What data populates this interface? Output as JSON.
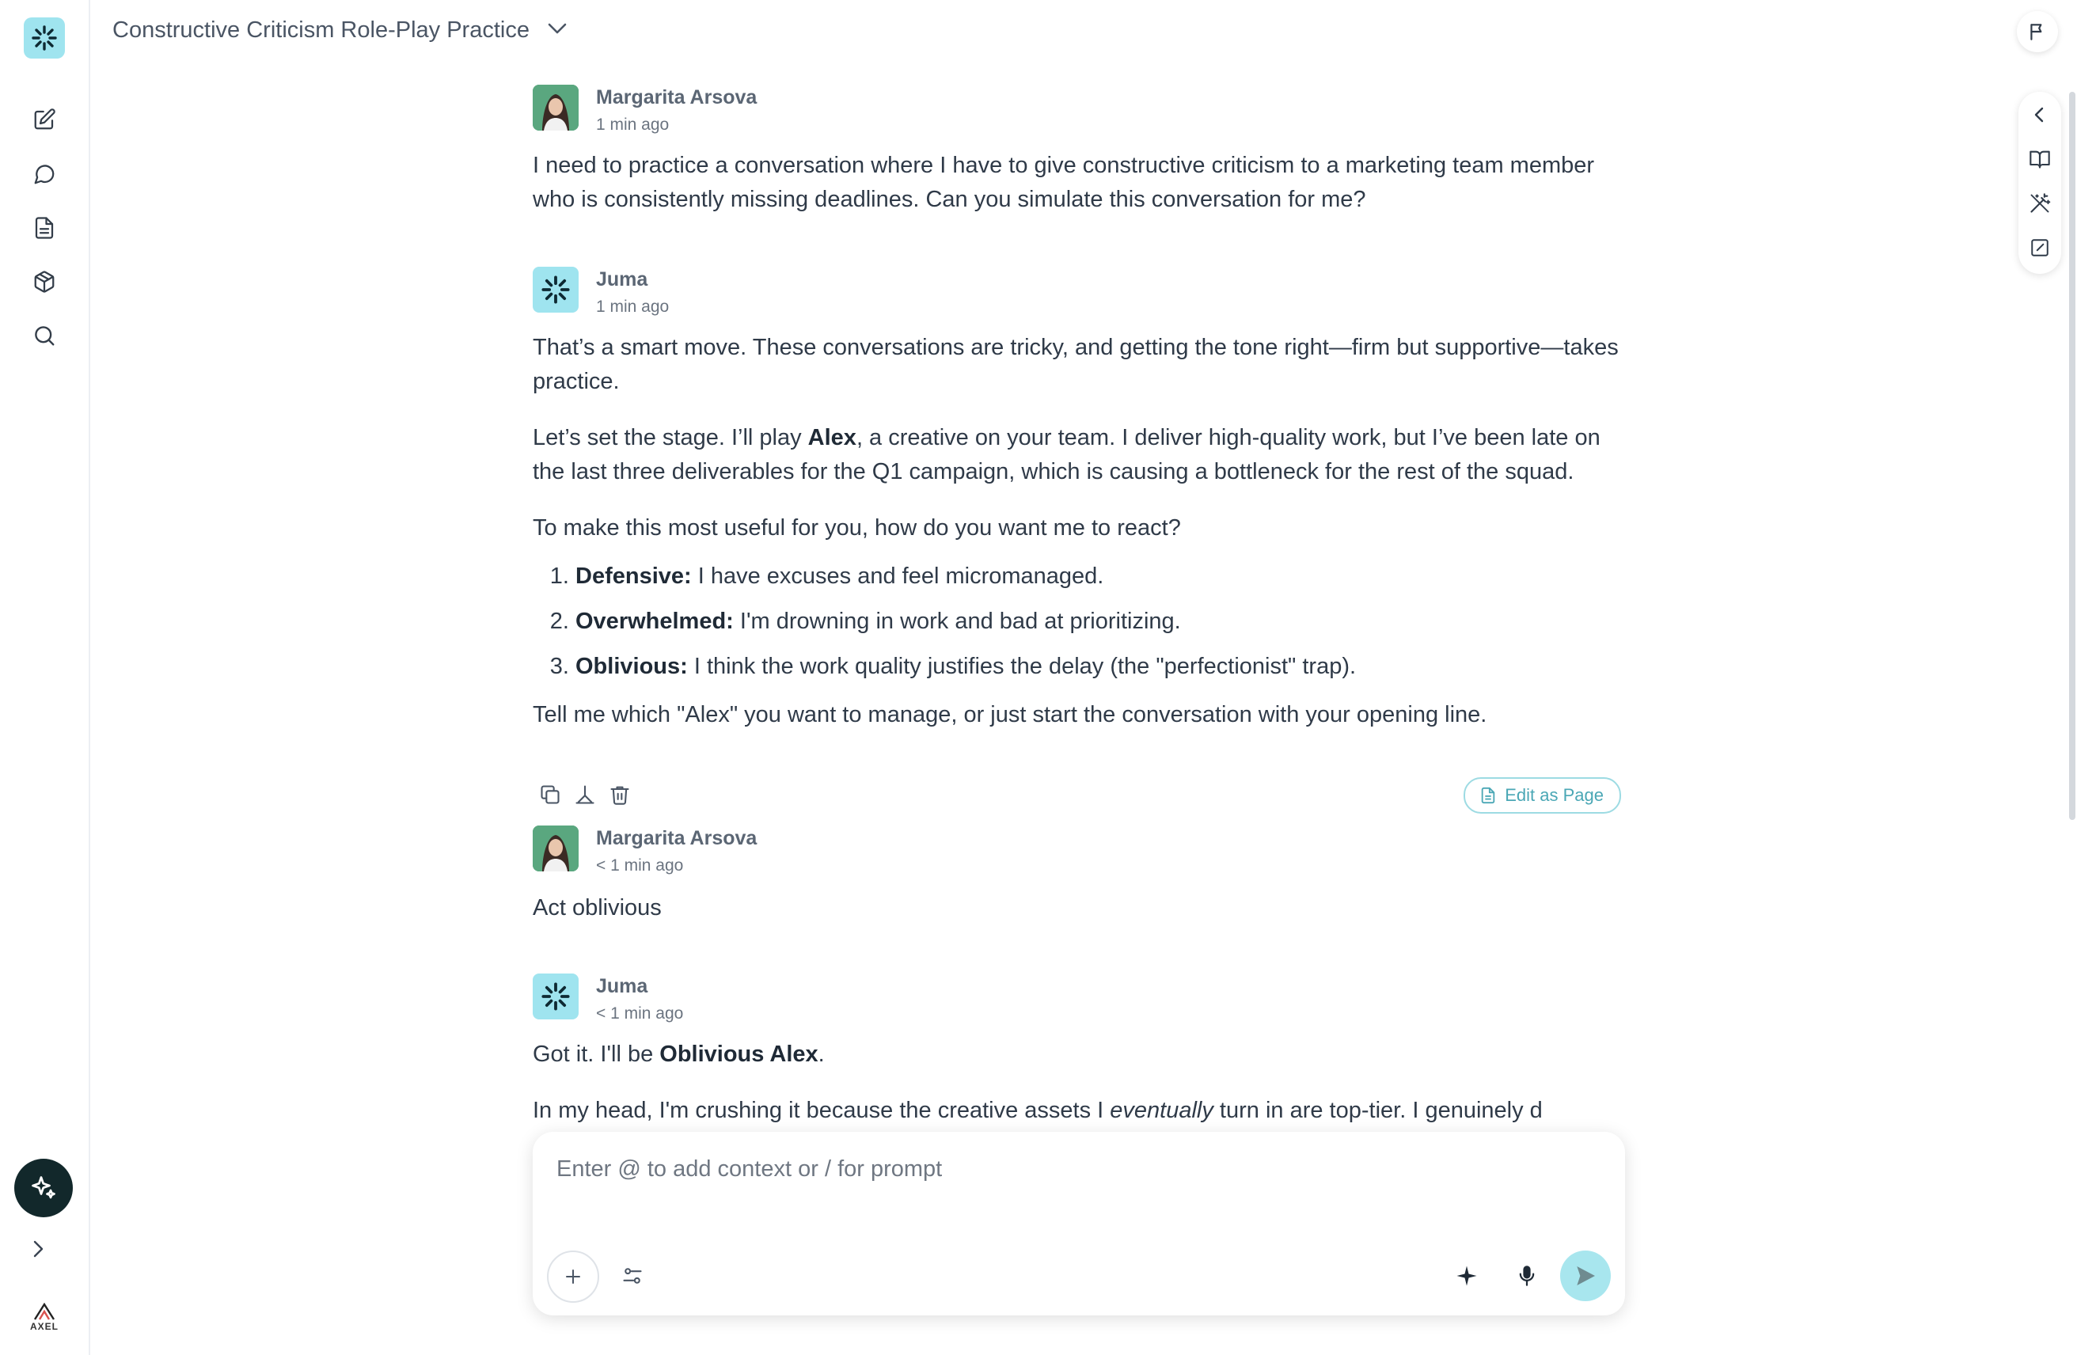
{
  "header": {
    "conversation_title": "Constructive Criticism Role-Play Practice"
  },
  "sidebar": {
    "items": [
      {
        "name": "new-note",
        "icon": "edit-icon"
      },
      {
        "name": "chats",
        "icon": "chat-bubble-icon"
      },
      {
        "name": "documents",
        "icon": "document-icon"
      },
      {
        "name": "packages",
        "icon": "cube-icon"
      },
      {
        "name": "search",
        "icon": "search-icon"
      }
    ],
    "brand_text": "AXEL"
  },
  "messages": [
    {
      "author": "Margarita Arsova",
      "time": "1 min ago",
      "text": "I need to practice a conversation where I have to give constructive criticism to a marketing team member who is consistently missing deadlines. Can you simulate this conversation for me?"
    },
    {
      "author": "Juma",
      "time": "1 min ago",
      "p1": "That’s a smart move. These conversations are tricky, and getting the tone right—firm but supportive—takes practice.",
      "p2_a": "Let’s set the stage. I’ll play ",
      "p2_bold": "Alex",
      "p2_b": ", a creative on your team. I deliver high-quality work, but I’ve been late on the last three deliverables for the Q1 campaign, which is causing a bottleneck for the rest of the squad.",
      "p3": "To make this most useful for you, how do you want me to react?",
      "options": [
        {
          "label": "Defensive:",
          "text": " I have excuses and feel micromanaged."
        },
        {
          "label": "Overwhelmed:",
          "text": " I'm drowning in work and bad at prioritizing."
        },
        {
          "label": "Oblivious:",
          "text": " I think the work quality justifies the delay (the \"perfectionist\" trap)."
        }
      ],
      "p4": "Tell me which \"Alex\" you want to manage, or just start the conversation with your opening line."
    },
    {
      "author": "Margarita Arsova",
      "time": "< 1 min ago",
      "text": "Act oblivious"
    },
    {
      "author": "Juma",
      "time": "< 1 min ago",
      "p1_a": "Got it. I'll be ",
      "p1_bold": "Oblivious Alex",
      "p1_b": ".",
      "p2_a": "In my head, I'm crushing it because the creative assets I ",
      "p2_italic": "eventually",
      "p2_b": " turn in are top-tier. I genuinely d"
    }
  ],
  "message_actions": {
    "edit_as_page": "Edit as Page"
  },
  "composer": {
    "placeholder": "Enter @ to add context or / for prompt",
    "value": ""
  },
  "colors": {
    "accent": "#9fe4ef",
    "accent_text": "#4aa7b5",
    "fab": "#12282b",
    "user_avatar": "#5aa77f"
  }
}
